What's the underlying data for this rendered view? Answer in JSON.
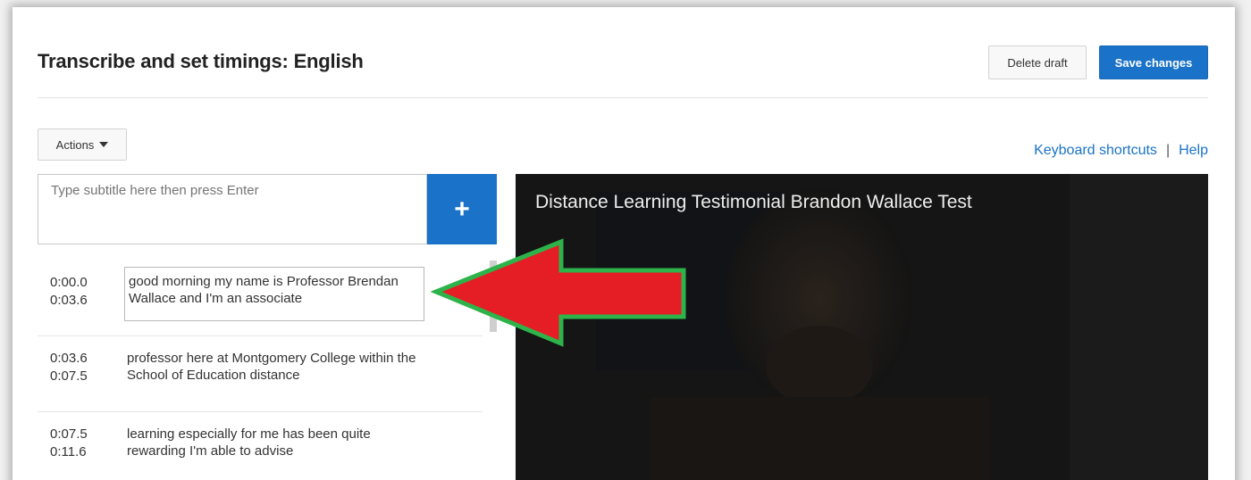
{
  "header": {
    "title": "Transcribe and set timings: English",
    "delete_label": "Delete draft",
    "save_label": "Save changes"
  },
  "toolbar": {
    "actions_label": "Actions",
    "keyboard_shortcuts": "Keyboard shortcuts",
    "separator": "|",
    "help": "Help"
  },
  "subtitle_input": {
    "placeholder": "Type subtitle here then press Enter",
    "value": ""
  },
  "add_button": {
    "label": "+"
  },
  "captions": [
    {
      "start": "0:00.0",
      "end": "0:03.6",
      "text": "good morning my name is Professor Brendan Wallace and I'm an associate"
    },
    {
      "start": "0:03.6",
      "end": "0:07.5",
      "text": "professor here at Montgomery College within the School of Education distance"
    },
    {
      "start": "0:07.5",
      "end": "0:11.6",
      "text": "learning especially for me has been quite rewarding I'm able to advise"
    }
  ],
  "video": {
    "title": "Distance Learning Testimonial Brandon Wallace Test"
  },
  "colors": {
    "accent": "#1a73c8",
    "arrow_fill": "#e51d24",
    "arrow_border": "#2db34a"
  }
}
